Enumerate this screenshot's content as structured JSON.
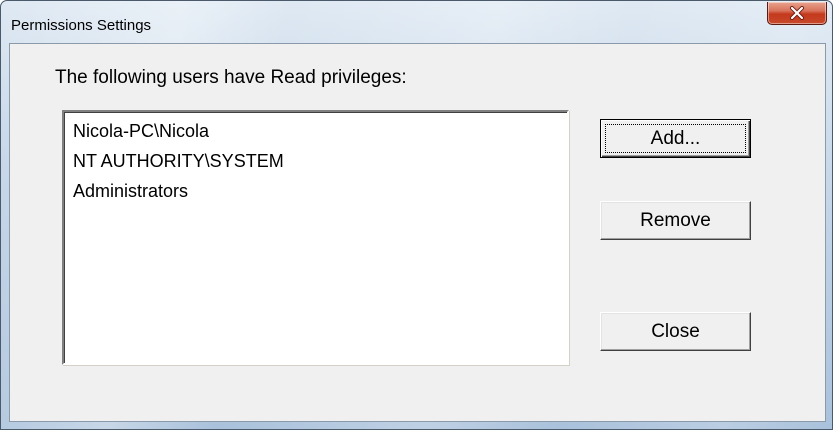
{
  "window": {
    "title": "Permissions Settings",
    "close_icon": "close-icon"
  },
  "dialog": {
    "prompt": "The following users have Read privileges:",
    "users": [
      "Nicola-PC\\Nicola",
      "NT AUTHORITY\\SYSTEM",
      "Administrators"
    ],
    "buttons": {
      "add": "Add...",
      "remove": "Remove",
      "close": "Close"
    }
  },
  "colors": {
    "close_button": "#c4391c",
    "dialog_face": "#f0f0f0",
    "frame_accent": "#b9cde3"
  }
}
